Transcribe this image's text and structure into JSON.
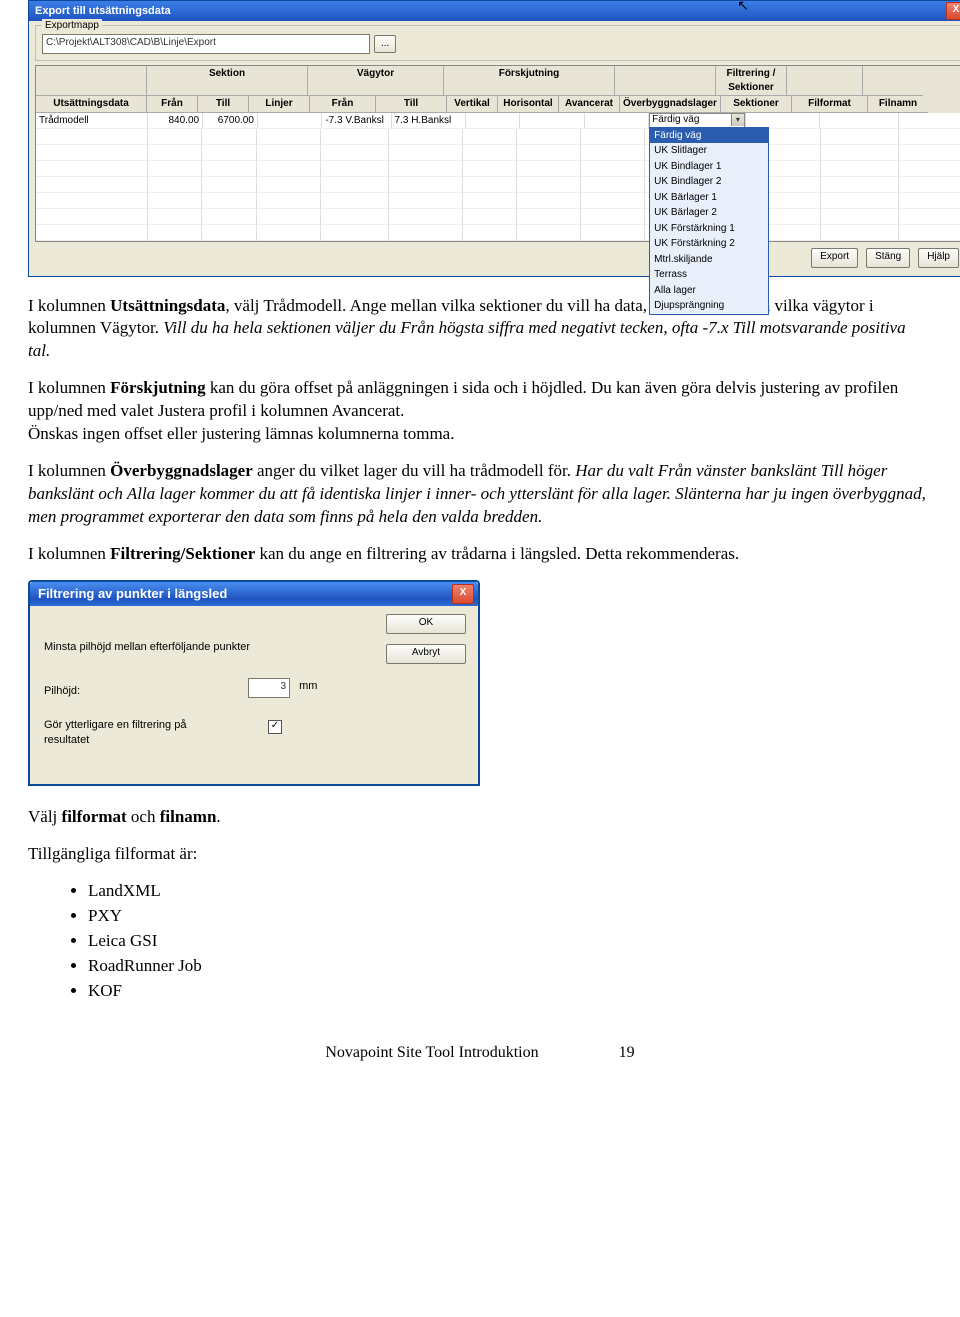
{
  "dialog1": {
    "title": "Export till utsättningsdata",
    "close_x": "X",
    "group_label": "Exportmapp",
    "path": "C:\\Projekt\\ALT308\\CAD\\B\\Linje\\Export",
    "browse": "...",
    "groups": {
      "sektion": "Sektion",
      "vagytor": "Vägytor",
      "forskjutning": "Förskjutning",
      "filtrering": "Filtrering / Sektioner"
    },
    "headers": {
      "us": "Utsättningsdata",
      "fran": "Från",
      "till": "Till",
      "linjer": "Linjer",
      "vfran": "Från",
      "vtill": "Till",
      "vertikal": "Vertikal",
      "horisontal": "Horisontal",
      "avancerat": "Avancerat",
      "overbygg": "Överbyggnadslager",
      "filsek": "Sektioner",
      "filformat": "Filformat",
      "filnamn": "Filnamn"
    },
    "row": {
      "us": "Trådmodell",
      "fran": "840.00",
      "till": "6700.00",
      "vfran": "-7.3 V.Banksl",
      "vtill": "7.3 H.Banksl",
      "overbygg": "Färdig väg"
    },
    "dropdown_items": [
      "Färdig väg",
      "UK Slitlager",
      "UK Bindlager 1",
      "UK Bindlager 2",
      "UK Bärlager 1",
      "UK Bärlager 2",
      "UK Förstärkning 1",
      "UK Förstärkning 2",
      "Mtrl.skiljande",
      "Terrass",
      "Alla lager",
      "Djupsprängning"
    ],
    "btn_export": "Export",
    "btn_stang": "Stäng",
    "btn_hjalp": "Hjälp"
  },
  "para1a": "I kolumnen ",
  "para1b": "Utsättningsdata",
  "para1c": ", välj Trådmodell. Ange mellan vilka sektioner du vill ha data, välj sedan mellan vilka vägytor i kolumnen Vägytor. ",
  "para1d": "Vill du ha hela sektionen väljer du Från högsta siffra med negativt tecken, ofta -7.x Till motsvarande positiva tal.",
  "para2a": "I kolumnen ",
  "para2b": "Förskjutning",
  "para2c": " kan du göra offset på anläggningen i sida och i höjdled. Du kan även göra delvis justering av profilen upp/ned med valet Justera profil i kolumnen Avancerat.",
  "para2d": "Önskas ingen offset eller justering lämnas kolumnerna tomma.",
  "para3a": "I kolumnen ",
  "para3b": "Överbyggnadslager",
  "para3c": " anger du vilket lager du vill ha trådmodell för. ",
  "para3d": "Har du valt Från vänster bankslänt Till höger bankslänt och Alla lager kommer du att få identiska linjer i inner- och ytterslänt för alla lager. Slänterna har ju ingen överbyggnad, men programmet exporterar den data som finns på hela den valda bredden.",
  "para4a": "I kolumnen ",
  "para4b": "Filtrering/Sektioner",
  "para4c": " kan du ange en filtrering av trådarna i längsled. Detta rekommenderas.",
  "dialog2": {
    "title": "Filtrering av punkter i längsled",
    "close_x": "X",
    "label_minsta": "Minsta pilhöjd mellan efterföljande punkter",
    "label_pilhojd": "Pilhöjd:",
    "pilhojd_val": "3",
    "pilhojd_unit": "mm",
    "label_gor": "Gör ytterligare en filtrering på resultatet",
    "chk_mark": "✓",
    "btn_ok": "OK",
    "btn_avbryt": "Avbryt"
  },
  "para5a": "Välj ",
  "para5b": "filformat",
  "para5c": " och ",
  "para5d": "filnamn",
  "para5e": ".",
  "para6": "Tillgängliga filformat är:",
  "formats": [
    "LandXML",
    "PXY",
    "Leica GSI",
    "RoadRunner Job",
    "KOF"
  ],
  "footer_text": "Novapoint Site Tool Introduktion",
  "footer_page": "19"
}
